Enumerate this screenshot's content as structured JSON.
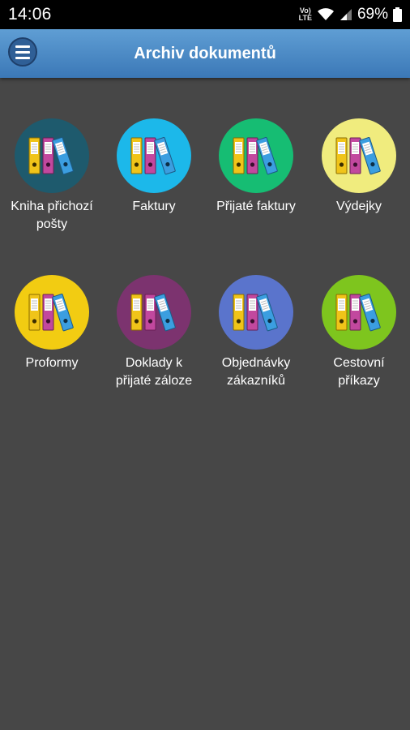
{
  "status_bar": {
    "time": "14:06",
    "volte_line1": "Vo)",
    "volte_line2": "LTE",
    "battery": "69%"
  },
  "app_bar": {
    "title": "Archiv dokumentů",
    "menu_icon": "hamburger-menu-icon"
  },
  "tiles": [
    {
      "label": "Kniha přichozí pošty",
      "color": "#1e5a6d"
    },
    {
      "label": "Faktury",
      "color": "#1cb8ea"
    },
    {
      "label": "Přijaté faktury",
      "color": "#16bd73"
    },
    {
      "label": "Výdejky",
      "color": "#f0ec7e"
    },
    {
      "label": "Proformy",
      "color": "#f2cc12"
    },
    {
      "label": "Doklady k přijaté záloze",
      "color": "#7c336f"
    },
    {
      "label": "Objednávky zákazníků",
      "color": "#5a74cc"
    },
    {
      "label": "Cestovní příkazy",
      "color": "#7ec51e"
    }
  ],
  "binder_icon": "document-binders-icon"
}
